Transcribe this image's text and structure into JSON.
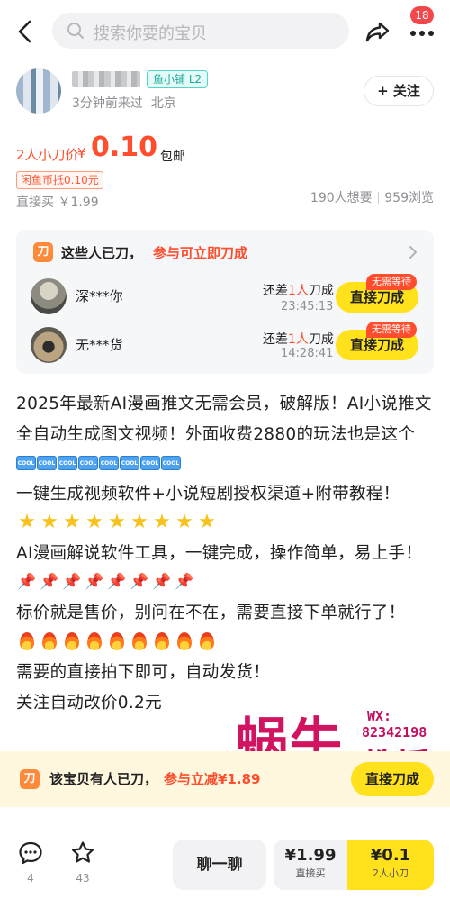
{
  "topbar": {
    "search_placeholder": "搜索你要的宝贝",
    "notification_count": "18"
  },
  "seller": {
    "badge": "鱼小铺 L2",
    "last_seen": "3分钟前来过",
    "location": "北京",
    "follow_label": "+ 关注"
  },
  "price": {
    "label": "2人小刀价",
    "currency": "¥",
    "value": "0.10",
    "shipping": "包邮",
    "coin_tag": "闲鱼币抵0.10元",
    "direct_buy": "直接买 ￥1.99",
    "wants": "190人想要",
    "views": "959浏览"
  },
  "cut_box": {
    "title": "这些人已刀，",
    "title_highlight": "参与可立即刀成",
    "rows": [
      {
        "name": "深***你",
        "diff_prefix": "还差",
        "diff_count": "1人",
        "diff_suffix": "刀成",
        "time": "23:45:13",
        "button": "直接刀成",
        "tag": "无需等待"
      },
      {
        "name": "无***货",
        "diff_prefix": "还差",
        "diff_count": "1人",
        "diff_suffix": "刀成",
        "time": "14:28:41",
        "button": "直接刀成",
        "tag": "无需等待"
      }
    ]
  },
  "description": {
    "p1": "2025年最新AI漫画推文无需会员，破解版！AI小说推文全自动生成图文视频！外面收费2880的玩法也是这个",
    "p2": "一键生成视频软件+小说短剧授权渠道+附带教程！",
    "p3": "AI漫画解说软件工具，一键完成，操作简单，易上手！",
    "p4": "标价就是售价，别问在不在，需要直接下单就行了！",
    "p5": "需要的直接拍下即可，自动发货！",
    "p6": "关注自动改价0.2元",
    "cool_text": "COOL"
  },
  "watermark": {
    "text": "蜗牛",
    "sub": "教授",
    "wx_label": "WX:",
    "wx_number": "82342198"
  },
  "strip": {
    "text": "该宝贝有人已刀，",
    "highlight": "参与立减¥1.89",
    "button": "直接刀成"
  },
  "actionbar": {
    "comments": "4",
    "favorites": "43",
    "chat": "聊一聊",
    "buy_price": "¥1.99",
    "buy_label": "直接买",
    "cut_price": "¥0.1",
    "cut_label": "2人小刀"
  },
  "icons": {
    "cut": "刀"
  },
  "colors": {
    "accent": "#ff4d2d",
    "yellow": "#ffe11c"
  }
}
